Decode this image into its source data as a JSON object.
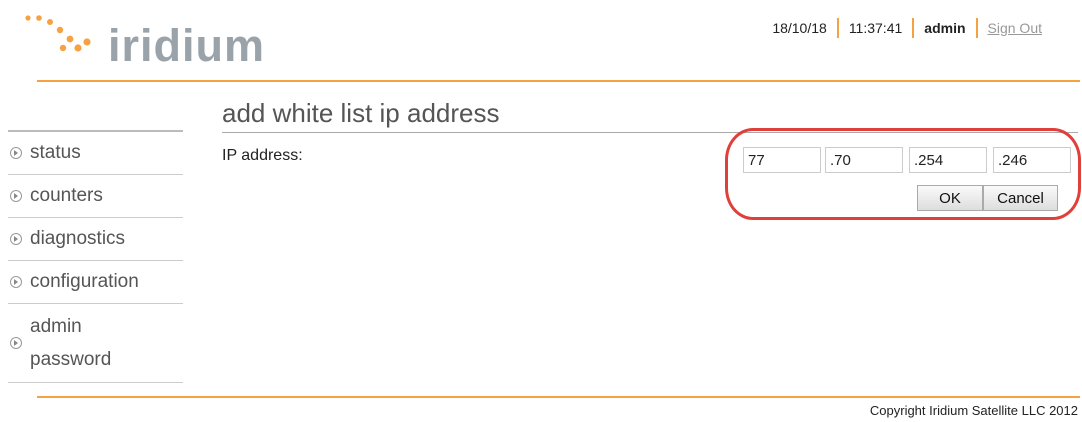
{
  "brand": {
    "name": "iridium",
    "accent": "#f5a243",
    "logo_dot_color": "#f5a243"
  },
  "header": {
    "date": "18/10/18",
    "time": "11:37:41",
    "user": "admin",
    "signout_label": "Sign Out"
  },
  "sidebar": {
    "items": [
      {
        "label": "status",
        "icon": "expand-bullet-icon"
      },
      {
        "label": "counters",
        "icon": "expand-bullet-icon"
      },
      {
        "label": "diagnostics",
        "icon": "expand-bullet-icon"
      },
      {
        "label": "configuration",
        "icon": "expand-bullet-icon"
      },
      {
        "label": "admin password",
        "icon": "expand-bullet-icon"
      }
    ]
  },
  "main": {
    "title": "add white list ip address",
    "ip_label": "IP address:",
    "ip_octets": [
      "77",
      ".70",
      ".254",
      ".246"
    ],
    "ok_label": "OK",
    "cancel_label": "Cancel"
  },
  "footer": {
    "copyright": "Copyright Iridium Satellite LLC 2012"
  },
  "annotation_color": "#e0403a"
}
